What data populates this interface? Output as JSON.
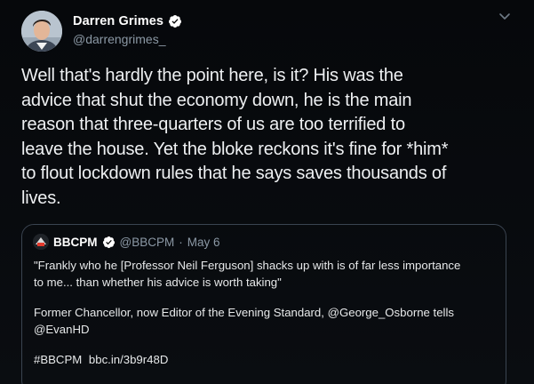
{
  "tweet": {
    "author": {
      "name": "Darren Grimes",
      "handle": "@darrengrimes_"
    },
    "text_lines": [
      "Well that's hardly the point here, is it? His was the",
      "advice that shut the economy down, he is the main",
      "reason that three-quarters of us are too terrified to",
      "leave the house. Yet the bloke reckons it's fine for *him*",
      "to flout lockdown rules that he says saves thousands of",
      "lives."
    ]
  },
  "quoted": {
    "author": {
      "name": "BBCPM",
      "handle": "@BBCPM",
      "separator": "·",
      "date": "May 6"
    },
    "paragraph1_lines": [
      "\"Frankly who he [Professor Neil Ferguson] shacks up with is of far less importance",
      "to me... than whether his advice is worth taking\""
    ],
    "paragraph2_lines": [
      "Former Chancellor, now Editor of the Evening Standard, @George_Osborne tells",
      "@EvanHD"
    ],
    "hashtag": "#BBCPM",
    "link": "bbc.in/3b9r48D"
  },
  "icons": {
    "verified": "verified-badge-icon",
    "more": "chevron-down-icon"
  },
  "colors": {
    "background": "#000000",
    "verified_badge": "#ffffff",
    "secondary_text": "#8b98a5",
    "quote_border": "#3a4450"
  }
}
